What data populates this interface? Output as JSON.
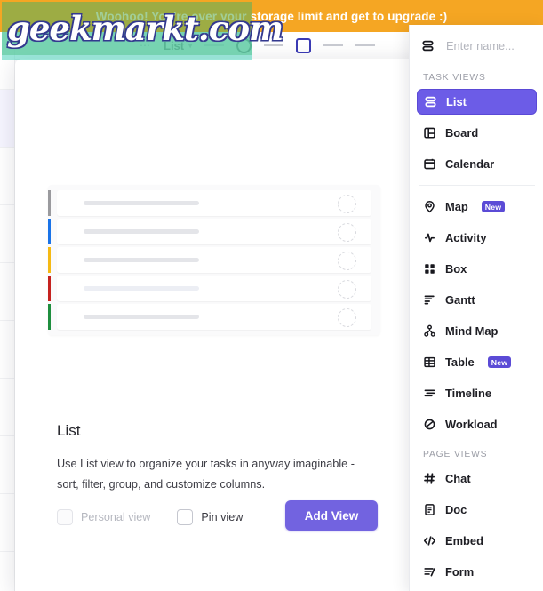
{
  "banner": {
    "text": "Woohoo! You're over your storage limit and get to upgrade :)",
    "bg_color": "#f5a623",
    "text_color": "#ffffff"
  },
  "watermark": {
    "text": "geekmarkt.com",
    "box_color_top": "#68b058",
    "box_color_bottom": "#5ed6c2"
  },
  "background_toolbar": {
    "view_label": "List",
    "caret": "▾",
    "dots": "⋯"
  },
  "preview": {
    "title": "List",
    "description": "Use List view to organize your tasks in anyway imaginable - sort, filter, group, and customize columns.",
    "rows": [
      {
        "accent": "#9a9a9e"
      },
      {
        "accent": "#1a73e8"
      },
      {
        "accent": "#f5b914"
      },
      {
        "accent": "#c5221f"
      },
      {
        "accent": "#1e8e3e"
      }
    ]
  },
  "controls": {
    "personal_view_label": "Personal view",
    "personal_view_checked": false,
    "personal_view_disabled": true,
    "pin_view_label": "Pin view",
    "pin_view_checked": false,
    "add_view_label": "Add View",
    "accent_color": "#7263e0"
  },
  "views_panel": {
    "name_input": {
      "value": "",
      "placeholder": "Enter name..."
    },
    "task_views_header": "TASK VIEWS",
    "task_views": [
      {
        "label": "List",
        "icon": "list-icon",
        "active": true,
        "badge": null
      },
      {
        "label": "Board",
        "icon": "board-icon",
        "active": false,
        "badge": null
      },
      {
        "label": "Calendar",
        "icon": "calendar-icon",
        "active": false,
        "badge": null
      },
      {
        "label": "Map",
        "icon": "map-pin-icon",
        "active": false,
        "badge": "New"
      },
      {
        "label": "Activity",
        "icon": "activity-icon",
        "active": false,
        "badge": null
      },
      {
        "label": "Box",
        "icon": "box-grid-icon",
        "active": false,
        "badge": null
      },
      {
        "label": "Gantt",
        "icon": "gantt-icon",
        "active": false,
        "badge": null
      },
      {
        "label": "Mind Map",
        "icon": "mind-map-icon",
        "active": false,
        "badge": null
      },
      {
        "label": "Table",
        "icon": "table-icon",
        "active": false,
        "badge": "New"
      },
      {
        "label": "Timeline",
        "icon": "timeline-icon",
        "active": false,
        "badge": null
      },
      {
        "label": "Workload",
        "icon": "workload-icon",
        "active": false,
        "badge": null
      }
    ],
    "page_views_header": "PAGE VIEWS",
    "page_views": [
      {
        "label": "Chat",
        "icon": "hash-icon",
        "badge": null
      },
      {
        "label": "Doc",
        "icon": "doc-icon",
        "badge": null
      },
      {
        "label": "Embed",
        "icon": "code-icon",
        "badge": null
      },
      {
        "label": "Form",
        "icon": "form-icon",
        "badge": null
      }
    ],
    "active_color": "#6c5ce7",
    "badge_color": "#5b4bd6"
  }
}
